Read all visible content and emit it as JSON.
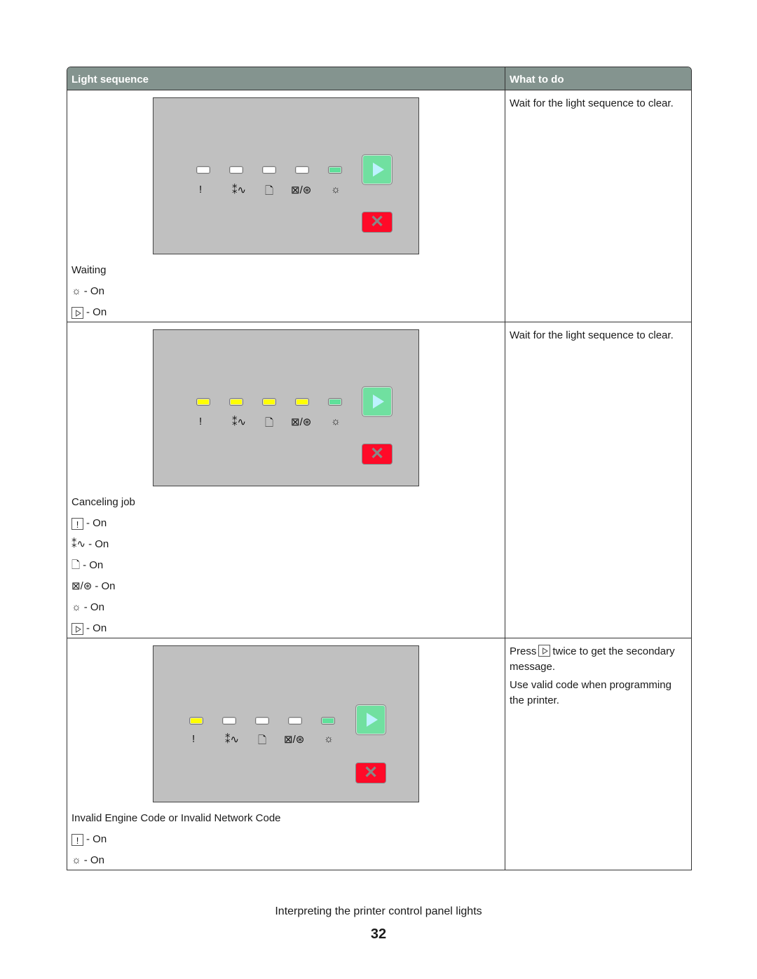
{
  "table": {
    "headers": {
      "light_sequence": "Light sequence",
      "what_to_do": "What to do"
    },
    "header_color": "#84948f",
    "rows": [
      {
        "status": "Waiting",
        "panel": {
          "leds": [
            "off",
            "off",
            "off",
            "off",
            "green"
          ]
        },
        "lights": [
          {
            "icon": "ready-light-icon",
            "state": "- On"
          },
          {
            "icon": "go-button-icon",
            "state": "- On"
          }
        ],
        "what_to_do": [
          "Wait for the light sequence to clear."
        ]
      },
      {
        "status": "Canceling job",
        "panel": {
          "leds": [
            "yellow",
            "yellow",
            "yellow",
            "yellow",
            "green"
          ]
        },
        "lights": [
          {
            "icon": "error-icon",
            "state": "- On"
          },
          {
            "icon": "paper-jam-icon",
            "state": "- On"
          },
          {
            "icon": "load-paper-icon",
            "state": "- On"
          },
          {
            "icon": "toner-photoconductor-icon",
            "state": "- On"
          },
          {
            "icon": "ready-light-icon",
            "state": "- On"
          },
          {
            "icon": "go-button-icon",
            "state": "- On"
          }
        ],
        "what_to_do": [
          "Wait for the light sequence to clear."
        ]
      },
      {
        "status": "Invalid Engine Code or Invalid Network Code",
        "panel": {
          "leds": [
            "yellow",
            "off",
            "off",
            "off",
            "green"
          ]
        },
        "lights": [
          {
            "icon": "error-icon",
            "state": "- On"
          },
          {
            "icon": "ready-light-icon",
            "state": "- On"
          }
        ],
        "what_to_do_press": {
          "before": "Press",
          "after": "twice to get the secondary message."
        },
        "what_to_do": [
          "Use valid code when programming the printer."
        ]
      }
    ]
  },
  "panel_symbols": {
    "error": "!",
    "paper_jam": "⁂",
    "load_paper": "🗋",
    "toner": "⊠/⊛",
    "ready": "☼"
  },
  "led_colors": {
    "off": "#ffffff",
    "yellow": "#ffff00",
    "green": "#5fe09a"
  },
  "button_colors": {
    "go": "#70e0a0",
    "stop": "#ff0a28"
  },
  "footer": {
    "title": "Interpreting the printer control panel lights",
    "page": "32"
  }
}
